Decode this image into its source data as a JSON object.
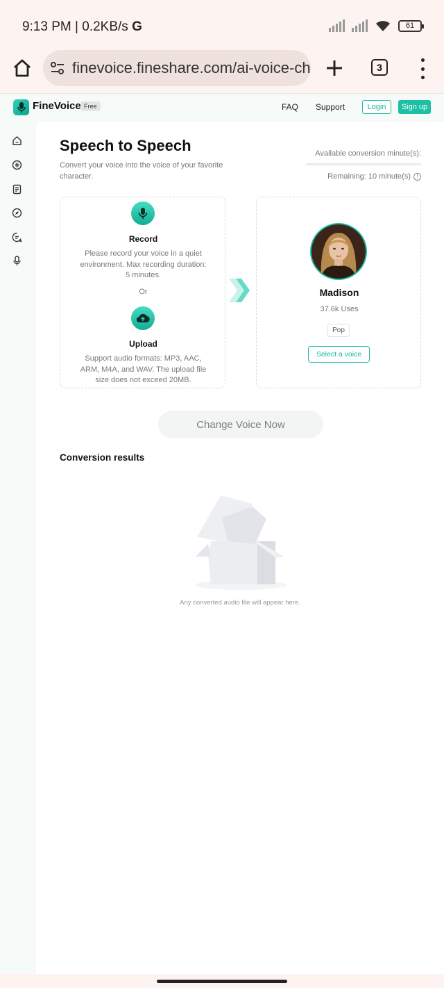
{
  "status_bar": {
    "time_speed": "9:13 PM | 0.2KB/s",
    "g_label": "G",
    "battery": "61"
  },
  "browser": {
    "url": "finevoice.fineshare.com/ai-voice-cha",
    "tab_count": "3"
  },
  "site_nav": {
    "brand": "FineVoice",
    "badge": "Free",
    "faq": "FAQ",
    "support": "Support",
    "login": "Login",
    "signup": "Sign up"
  },
  "sidebar": {
    "icons": [
      "home-icon",
      "voice-changer-icon",
      "document-icon",
      "compass-icon",
      "chat-icon",
      "microphone-icon"
    ]
  },
  "main": {
    "title": "Speech to Speech",
    "subtitle": "Convert your voice into the voice of your favorite character.",
    "available_label": "Available conversion minute(s):",
    "remaining_label": "Remaining: 10 minute(s)"
  },
  "record_card": {
    "record_title": "Record",
    "record_desc": "Please record your voice in a quiet environment. Max recording duration: 5 minutes.",
    "or_label": "Or",
    "upload_title": "Upload",
    "upload_desc": "Support audio formats: MP3, AAC, ARM, M4A, and WAV. The upload file size does not exceed 20MB."
  },
  "voice_card": {
    "name": "Madison",
    "uses": "37.6k Uses",
    "tag": "Pop",
    "select_label": "Select a voice"
  },
  "actions": {
    "change_voice": "Change Voice Now"
  },
  "results": {
    "title": "Conversion results",
    "empty_text": "Any converted audio file will appear here."
  },
  "colors": {
    "accent": "#1dbfa5",
    "background": "#fdf3f0"
  }
}
